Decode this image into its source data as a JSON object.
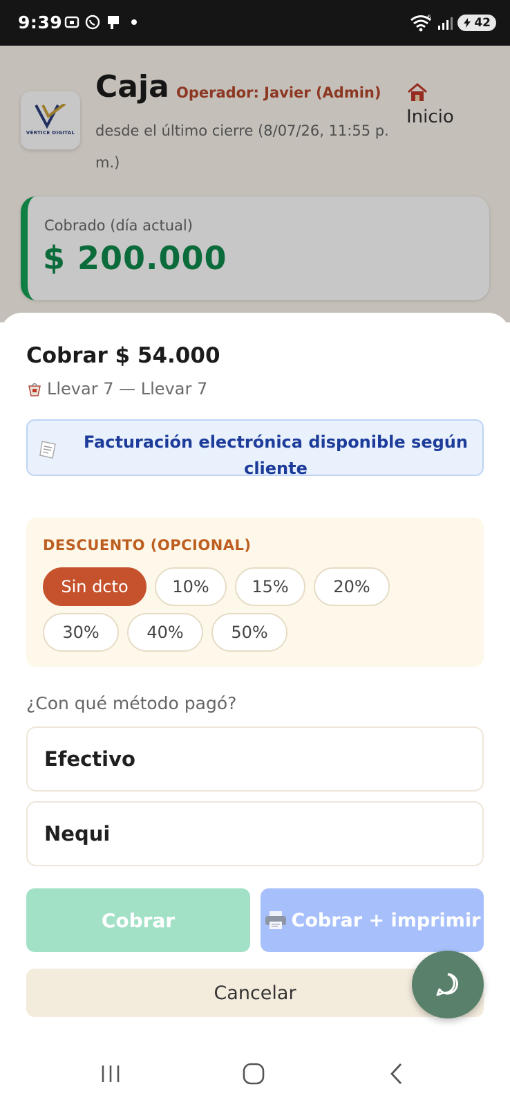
{
  "status_bar": {
    "time": "9:39",
    "battery": "42",
    "icons": [
      "screenshot-icon",
      "whatsapp-icon",
      "phone-case-icon",
      "notification-dot",
      "wifi-icon",
      "signal-icon",
      "battery-icon"
    ]
  },
  "app": {
    "logo_text": "VÉRTICE DIGITAL",
    "title": "Caja",
    "operator": "Operador: Javier (Admin)",
    "since": "desde el último cierre (8/07/26, 11:55 p. m.)",
    "home_label": "Inicio",
    "collected_label": "Cobrado (día actual)",
    "collected_value": "$ 200.000",
    "accent_green": "#0f8a4b"
  },
  "sheet": {
    "title": "Cobrar $ 54.000",
    "subtitle": "Llevar 7 — Llevar 7",
    "invoice_info": "Facturación electrónica disponible según cliente",
    "discount": {
      "label": "DESCUENTO (OPCIONAL)",
      "options": [
        "Sin dcto",
        "10%",
        "15%",
        "20%",
        "30%",
        "40%",
        "50%"
      ],
      "selected": "Sin dcto",
      "selected_color": "#c5522d"
    },
    "method_question": "¿Con qué método pagó?",
    "methods": [
      "Efectivo",
      "Nequi"
    ],
    "buttons": {
      "charge": "Cobrar",
      "charge_print": "Cobrar + imprimir",
      "cancel": "Cancelar"
    }
  },
  "fab": {
    "icon": "chat-bubble-icon"
  },
  "nav": {
    "icons": [
      "recents-icon",
      "home-icon",
      "back-icon"
    ]
  }
}
